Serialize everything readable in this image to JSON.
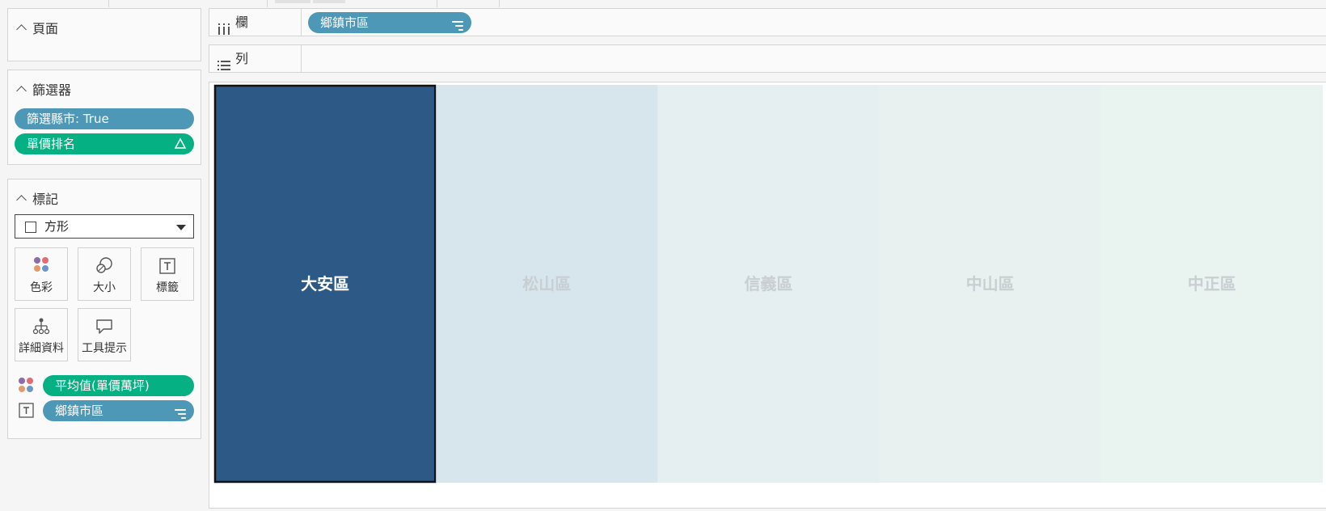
{
  "pages_card": {
    "title": "頁面"
  },
  "filters_card": {
    "title": "篩選器",
    "pills": [
      {
        "label": "篩選縣市: True",
        "color": "#4e98b7"
      },
      {
        "label": "單價排名",
        "color": "#05b082",
        "icon": "delta-icon"
      }
    ]
  },
  "marks_card": {
    "title": "標記",
    "mark_type": "方形",
    "buttons": [
      {
        "label": "色彩",
        "icon": "color-dots-icon"
      },
      {
        "label": "大小",
        "icon": "size-icon"
      },
      {
        "label": "標籤",
        "icon": "text-label-icon"
      },
      {
        "label": "詳細資料",
        "icon": "detail-icon"
      },
      {
        "label": "工具提示",
        "icon": "tooltip-icon"
      }
    ],
    "fields": [
      {
        "label": "平均值(單價萬坪)",
        "encoding": "color",
        "color": "#05b082"
      },
      {
        "label": "鄉鎮市區",
        "encoding": "label",
        "color": "#4e98b7",
        "icon": "sort-icon"
      }
    ]
  },
  "columns_shelf": {
    "label": "欄",
    "pill": "鄉鎮市區"
  },
  "rows_shelf": {
    "label": "列"
  },
  "chart_data": {
    "type": "heatmap",
    "mark": "square",
    "categories": [
      "大安區",
      "松山區",
      "信義區",
      "中山區",
      "中正區"
    ],
    "colors": [
      "#2d5986",
      "#d7e6ec",
      "#e5eef0",
      "#e8f1ef",
      "#e9f3ef"
    ],
    "label_colors": [
      "#ffffff",
      "#c8ced2",
      "#c8ced2",
      "#c8ced2",
      "#c8ced2"
    ],
    "selected": "大安區",
    "color_encoding": "平均值(單價萬坪)",
    "label_encoding": "鄉鎮市區"
  }
}
